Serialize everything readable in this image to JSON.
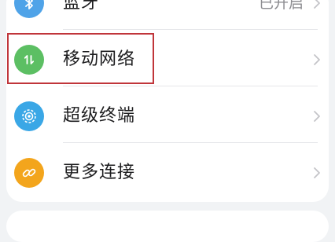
{
  "settings": {
    "items": [
      {
        "label": "蓝牙",
        "value": "已开启",
        "icon": "bluetooth-icon",
        "color": "#4fa3e8"
      },
      {
        "label": "移动网络",
        "value": "",
        "icon": "mobile-data-icon",
        "color": "#5cbf63"
      },
      {
        "label": "超级终端",
        "value": "",
        "icon": "super-device-icon",
        "color": "#3aa7e6"
      },
      {
        "label": "更多连接",
        "value": "",
        "icon": "link-icon",
        "color": "#f3a51c"
      }
    ]
  },
  "highlight": {
    "target": "移动网络",
    "color": "#c0353a"
  }
}
